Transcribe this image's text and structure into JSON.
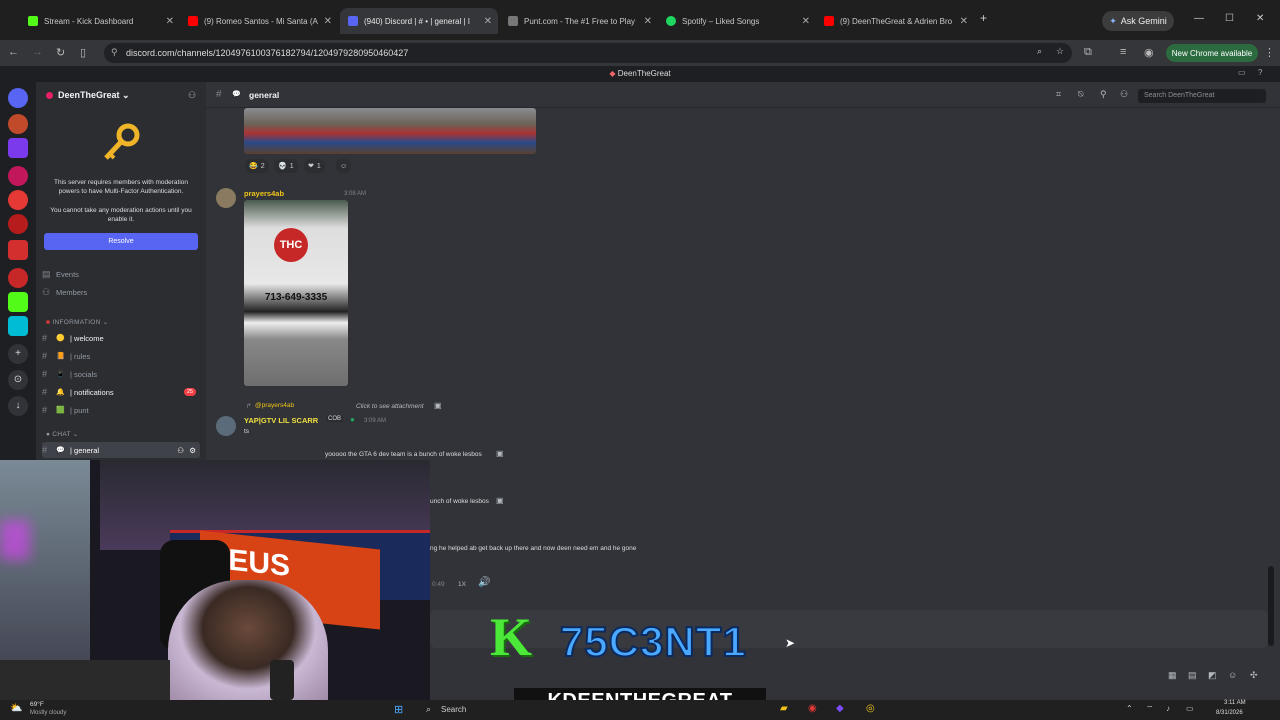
{
  "browser": {
    "tabs": [
      {
        "label": "Stream - Kick Dashboard",
        "color": "#53fc18"
      },
      {
        "label": "(9) Romeo Santos - Mi Santa (A",
        "color": "#ff0000"
      },
      {
        "label": "(940) Discord | # • | general | I",
        "color": "#5865f2"
      },
      {
        "label": "Punt.com - The #1 Free to Play",
        "color": "#ffffff"
      },
      {
        "label": "Spotify – Liked Songs",
        "color": "#1ed760"
      },
      {
        "label": "(9) DeenTheGreat & Adrien Bro",
        "color": "#ff0000"
      }
    ],
    "gemini_label": "Ask Gemini",
    "url": "discord.com/channels/1204976100376182794/1204979280950460427",
    "new_chrome": "New Chrome available"
  },
  "discord": {
    "window_title": "DeenTheGreat",
    "server_name": "DeenTheGreat",
    "mfa_notice": "This server requires members with moderation powers to have Multi-Factor Authentication.",
    "mfa_notice2": "You cannot take any moderation actions until you enable it.",
    "resolve_label": "Resolve",
    "nav": {
      "events": "Events",
      "members": "Members"
    },
    "category_info": "INFORMATION",
    "category_chat": "CHAT",
    "channels": [
      {
        "label": "| welcome",
        "emoji": "🟡"
      },
      {
        "label": "| rules",
        "emoji": "📙"
      },
      {
        "label": "| socials",
        "emoji": "📱"
      },
      {
        "label": "| notifications",
        "emoji": "🔔",
        "badge": "25"
      },
      {
        "label": "| punt",
        "emoji": "🟩"
      }
    ],
    "current_channel": "| general",
    "header_channel": "general",
    "search_placeholder": "Search DeenTheGreat",
    "reactions": [
      "2",
      "1",
      "1"
    ],
    "messages": {
      "m1_user": "prayers4ab",
      "m1_time": "3:08 AM",
      "sign_text": "713-649-3335",
      "reply_user": "@prayers4ab",
      "reply_text": "Click to see attachment",
      "m2_user": "YAP|GTV LIL SCARR",
      "m2_tag": "COB",
      "m2_time": "3:09 AM",
      "m2_text": "ts",
      "m3_text": "yooooo the GTA 6 dev team is a bunch of woke lesbos",
      "m4_text": "unch of woke lesbos",
      "m5_text": "ng he helped ab get back up there and now deen need em and he gone",
      "voice_time": "0:49",
      "voice_speed": "1X"
    }
  },
  "overlay": {
    "kick_letter": "K",
    "kick_handle": "75C3NT1",
    "streamer_label": "KDEENTHEGREAT",
    "cam_sign": "ZEUS"
  },
  "taskbar": {
    "weather_temp": "69°F",
    "weather_desc": "Mostly cloudy",
    "search_label": "Search",
    "time": "3:11 AM",
    "date": "8/31/2026"
  }
}
